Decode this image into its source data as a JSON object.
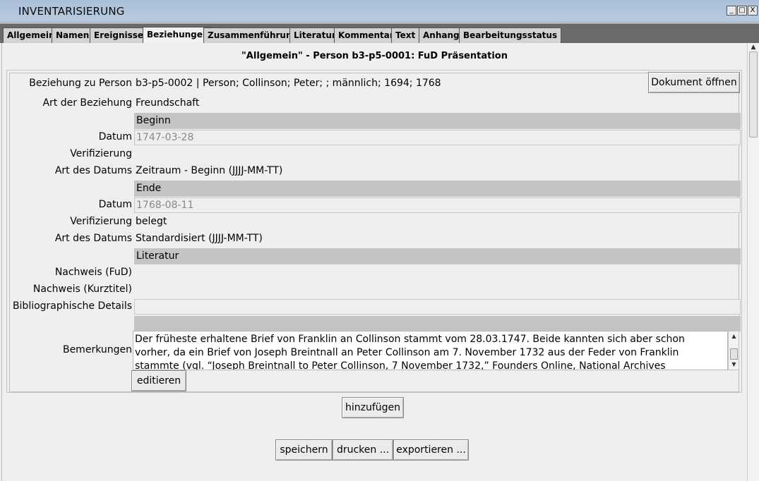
{
  "window": {
    "title": "INVENTARISIERUNG",
    "controls": [
      "_",
      "□",
      "X"
    ]
  },
  "tabs": [
    {
      "label": "Allgemein"
    },
    {
      "label": "Namen"
    },
    {
      "label": "Ereignisse"
    },
    {
      "label": "Beziehungen"
    },
    {
      "label": "Zusammenführung"
    },
    {
      "label": "Literatur"
    },
    {
      "label": "Kommentar"
    },
    {
      "label": "Text"
    },
    {
      "label": "Anhang"
    },
    {
      "label": "Bearbeitungsstatus"
    }
  ],
  "active_tab": "Beziehungen",
  "page_heading": "\"Allgemein\" - Person b3-p5-0001: FuD Präsentation",
  "relation": {
    "person_label": "Beziehung zu Person",
    "person_value": "b3-p5-0002 | Person; Collinson; Peter; ; männlich; 1694; 1768",
    "open_document_button": "Dokument öffnen",
    "type_label": "Art der Beziehung",
    "type_value": "Freundschaft",
    "begin": {
      "section": "Beginn",
      "date_label": "Datum",
      "date_value": "1747-03-28",
      "verification_label": "Verifizierung",
      "verification_value": "",
      "date_type_label": "Art des Datums",
      "date_type_value": "Zeitraum - Beginn (JJJJ-MM-TT)"
    },
    "end": {
      "section": "Ende",
      "date_label": "Datum",
      "date_value": "1768-08-11",
      "verification_label": "Verifizierung",
      "verification_value": "belegt",
      "date_type_label": "Art des Datums",
      "date_type_value": "Standardisiert (JJJJ-MM-TT)"
    },
    "literature": {
      "section": "Literatur",
      "proof_fud_label": "Nachweis (FuD)",
      "proof_short_label": "Nachweis (Kurztitel)",
      "biblio_label": "Bibliographische Details",
      "biblio_value": ""
    },
    "remarks_label": "Bemerkungen",
    "remarks_text": "Der früheste erhaltene Brief von Franklin an Collinson stammt vom 28.03.1747. Beide kannten sich aber schon vorher, da ein Brief von Joseph Breintnall an Peter Collinson am 7. November 1732 aus der Feder von Franklin stammte (vgl. “Joseph Breintnall to Peter Collinson, 7 November 1732,” Founders Online, National Archives",
    "edit_button": "editieren"
  },
  "add_button": "hinzufügen",
  "footer": {
    "save": "speichern",
    "print": "drucken ...",
    "export": "exportieren ..."
  }
}
